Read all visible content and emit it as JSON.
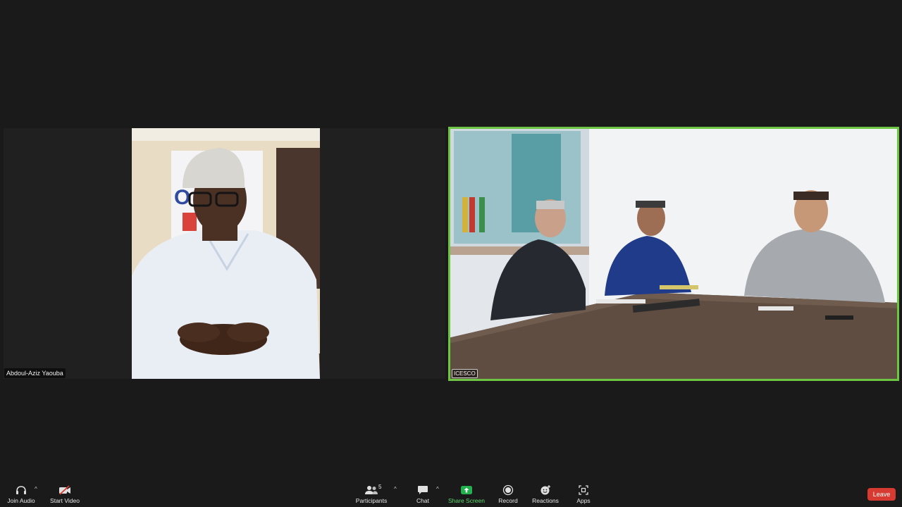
{
  "participants_tiles": {
    "left_name": "Abdoul-Aziz Yaouba",
    "right_name": "ICESCO"
  },
  "toolbar": {
    "join_audio": "Join Audio",
    "start_video": "Start Video",
    "participants": "Participants",
    "participants_count": "5",
    "chat": "Chat",
    "share_screen": "Share Screen",
    "record": "Record",
    "reactions": "Reactions",
    "apps": "Apps",
    "leave": "Leave"
  },
  "colors": {
    "active_speaker_border": "#6cc644",
    "share_green": "#23b14d",
    "leave_red": "#d63a30"
  }
}
